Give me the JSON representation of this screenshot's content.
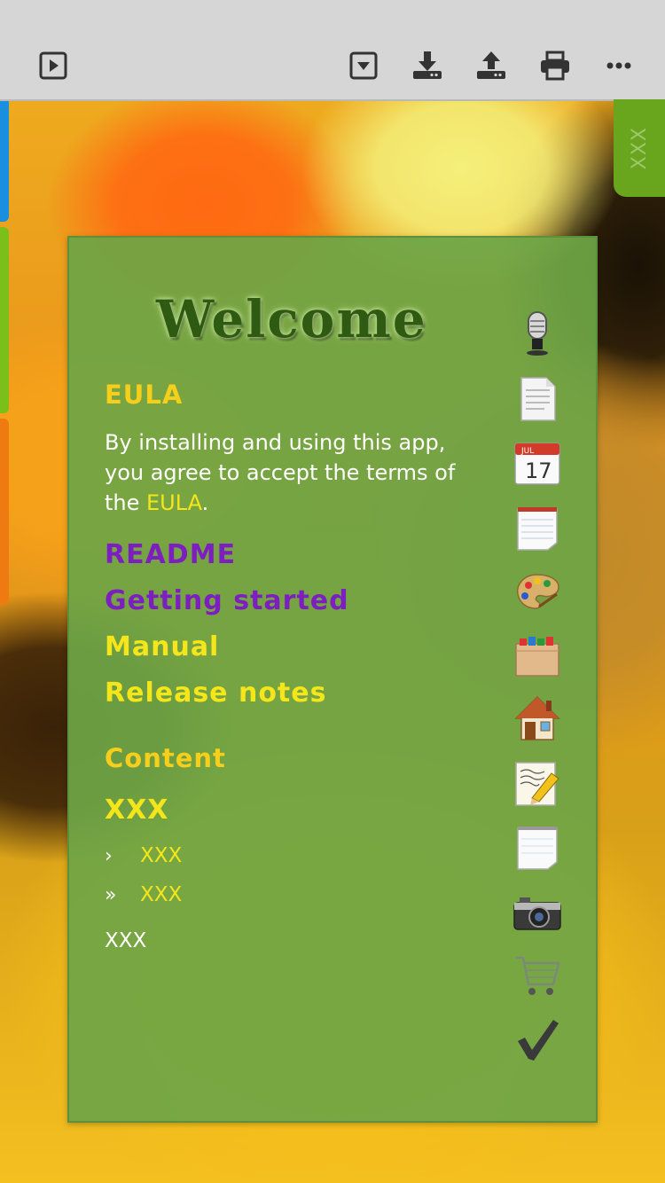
{
  "toolbar": {
    "buttons": [
      "play-icon",
      "dropdown-icon",
      "download-icon",
      "upload-icon",
      "print-icon",
      "more-icon"
    ]
  },
  "right_tab": {
    "label": "XXX"
  },
  "panel": {
    "title": "Welcome",
    "eula_heading": "EULA",
    "eula_text_before": "By installing and using this app, you agree to accept the terms of the ",
    "eula_link": "EULA",
    "eula_text_after": ".",
    "readme_heading": "README",
    "getting_started": "Getting started",
    "manual": "Manual",
    "release_notes": "Release notes",
    "content_heading": "Content",
    "xxx_heading": "XXX",
    "item1_chevron": "›",
    "item1_label": "XXX",
    "item2_chevron": "»",
    "item2_label": "XXX",
    "plain_item": "XXX"
  },
  "side_icons": [
    "microphone-icon",
    "document-icon",
    "calendar-icon",
    "notepad-icon",
    "palette-icon",
    "file-box-icon",
    "home-icon",
    "write-note-icon",
    "blank-note-icon",
    "camera-icon",
    "cart-icon",
    "checkmark-icon"
  ],
  "calendar": {
    "month": "JUL",
    "day": "17"
  },
  "colors": {
    "toolbar_bg": "#d6d6d6",
    "panel_bg": "#6ea546",
    "heading_yellow": "#f7cf1a",
    "heading_purple": "#7d1fc0",
    "link_yellow": "#f4e61a",
    "tab_blue": "#1a8fe0",
    "tab_green": "#7abf1a",
    "tab_orange": "#f07a12"
  }
}
